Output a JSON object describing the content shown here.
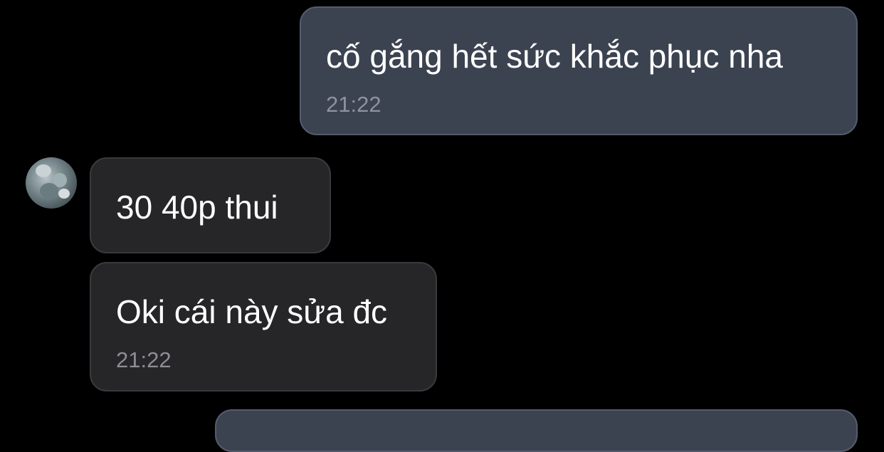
{
  "messages": [
    {
      "direction": "sent",
      "text": "cố gắng hết sức khắc phục nha",
      "time": "21:22"
    },
    {
      "direction": "received",
      "text": "30 40p thui"
    },
    {
      "direction": "received",
      "text": "Oki cái này sửa đc",
      "time": "21:22"
    },
    {
      "direction": "sent",
      "text": ""
    }
  ],
  "colors": {
    "background": "#000000",
    "sent_bubble": "#3b4250",
    "received_bubble": "#262628",
    "message_text": "#ffffff",
    "timestamp_text": "#8d939e"
  }
}
